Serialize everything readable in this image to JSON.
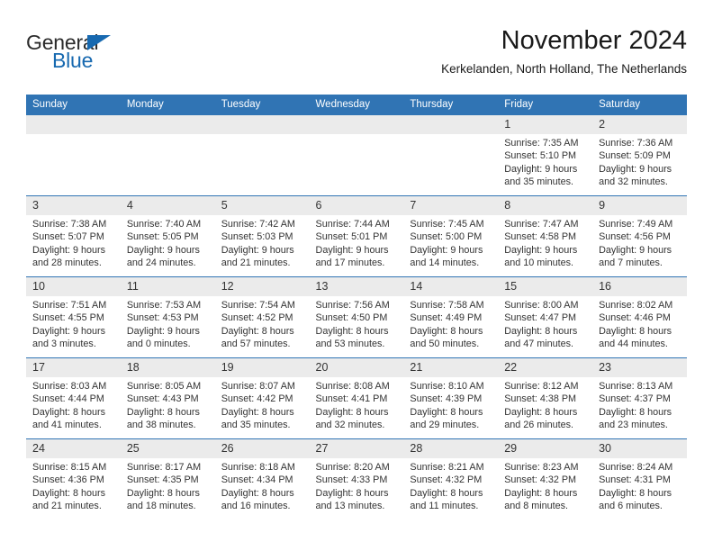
{
  "brand": {
    "name_part1": "General",
    "name_part2": "Blue",
    "triangle_color": "#1769b0",
    "accent_color": "#3074b4"
  },
  "header": {
    "title": "November 2024",
    "location": "Kerkelanden, North Holland, The Netherlands"
  },
  "calendar": {
    "weekday_headers": [
      "Sunday",
      "Monday",
      "Tuesday",
      "Wednesday",
      "Thursday",
      "Friday",
      "Saturday"
    ],
    "header_bg": "#3074b4",
    "daynum_bg": "#ebebeb",
    "weeks": [
      [
        {
          "day": "",
          "blank": true
        },
        {
          "day": "",
          "blank": true
        },
        {
          "day": "",
          "blank": true
        },
        {
          "day": "",
          "blank": true
        },
        {
          "day": "",
          "blank": true
        },
        {
          "day": "1",
          "sunrise": "Sunrise: 7:35 AM",
          "sunset": "Sunset: 5:10 PM",
          "daylight1": "Daylight: 9 hours",
          "daylight2": "and 35 minutes."
        },
        {
          "day": "2",
          "sunrise": "Sunrise: 7:36 AM",
          "sunset": "Sunset: 5:09 PM",
          "daylight1": "Daylight: 9 hours",
          "daylight2": "and 32 minutes."
        }
      ],
      [
        {
          "day": "3",
          "sunrise": "Sunrise: 7:38 AM",
          "sunset": "Sunset: 5:07 PM",
          "daylight1": "Daylight: 9 hours",
          "daylight2": "and 28 minutes."
        },
        {
          "day": "4",
          "sunrise": "Sunrise: 7:40 AM",
          "sunset": "Sunset: 5:05 PM",
          "daylight1": "Daylight: 9 hours",
          "daylight2": "and 24 minutes."
        },
        {
          "day": "5",
          "sunrise": "Sunrise: 7:42 AM",
          "sunset": "Sunset: 5:03 PM",
          "daylight1": "Daylight: 9 hours",
          "daylight2": "and 21 minutes."
        },
        {
          "day": "6",
          "sunrise": "Sunrise: 7:44 AM",
          "sunset": "Sunset: 5:01 PM",
          "daylight1": "Daylight: 9 hours",
          "daylight2": "and 17 minutes."
        },
        {
          "day": "7",
          "sunrise": "Sunrise: 7:45 AM",
          "sunset": "Sunset: 5:00 PM",
          "daylight1": "Daylight: 9 hours",
          "daylight2": "and 14 minutes."
        },
        {
          "day": "8",
          "sunrise": "Sunrise: 7:47 AM",
          "sunset": "Sunset: 4:58 PM",
          "daylight1": "Daylight: 9 hours",
          "daylight2": "and 10 minutes."
        },
        {
          "day": "9",
          "sunrise": "Sunrise: 7:49 AM",
          "sunset": "Sunset: 4:56 PM",
          "daylight1": "Daylight: 9 hours",
          "daylight2": "and 7 minutes."
        }
      ],
      [
        {
          "day": "10",
          "sunrise": "Sunrise: 7:51 AM",
          "sunset": "Sunset: 4:55 PM",
          "daylight1": "Daylight: 9 hours",
          "daylight2": "and 3 minutes."
        },
        {
          "day": "11",
          "sunrise": "Sunrise: 7:53 AM",
          "sunset": "Sunset: 4:53 PM",
          "daylight1": "Daylight: 9 hours",
          "daylight2": "and 0 minutes."
        },
        {
          "day": "12",
          "sunrise": "Sunrise: 7:54 AM",
          "sunset": "Sunset: 4:52 PM",
          "daylight1": "Daylight: 8 hours",
          "daylight2": "and 57 minutes."
        },
        {
          "day": "13",
          "sunrise": "Sunrise: 7:56 AM",
          "sunset": "Sunset: 4:50 PM",
          "daylight1": "Daylight: 8 hours",
          "daylight2": "and 53 minutes."
        },
        {
          "day": "14",
          "sunrise": "Sunrise: 7:58 AM",
          "sunset": "Sunset: 4:49 PM",
          "daylight1": "Daylight: 8 hours",
          "daylight2": "and 50 minutes."
        },
        {
          "day": "15",
          "sunrise": "Sunrise: 8:00 AM",
          "sunset": "Sunset: 4:47 PM",
          "daylight1": "Daylight: 8 hours",
          "daylight2": "and 47 minutes."
        },
        {
          "day": "16",
          "sunrise": "Sunrise: 8:02 AM",
          "sunset": "Sunset: 4:46 PM",
          "daylight1": "Daylight: 8 hours",
          "daylight2": "and 44 minutes."
        }
      ],
      [
        {
          "day": "17",
          "sunrise": "Sunrise: 8:03 AM",
          "sunset": "Sunset: 4:44 PM",
          "daylight1": "Daylight: 8 hours",
          "daylight2": "and 41 minutes."
        },
        {
          "day": "18",
          "sunrise": "Sunrise: 8:05 AM",
          "sunset": "Sunset: 4:43 PM",
          "daylight1": "Daylight: 8 hours",
          "daylight2": "and 38 minutes."
        },
        {
          "day": "19",
          "sunrise": "Sunrise: 8:07 AM",
          "sunset": "Sunset: 4:42 PM",
          "daylight1": "Daylight: 8 hours",
          "daylight2": "and 35 minutes."
        },
        {
          "day": "20",
          "sunrise": "Sunrise: 8:08 AM",
          "sunset": "Sunset: 4:41 PM",
          "daylight1": "Daylight: 8 hours",
          "daylight2": "and 32 minutes."
        },
        {
          "day": "21",
          "sunrise": "Sunrise: 8:10 AM",
          "sunset": "Sunset: 4:39 PM",
          "daylight1": "Daylight: 8 hours",
          "daylight2": "and 29 minutes."
        },
        {
          "day": "22",
          "sunrise": "Sunrise: 8:12 AM",
          "sunset": "Sunset: 4:38 PM",
          "daylight1": "Daylight: 8 hours",
          "daylight2": "and 26 minutes."
        },
        {
          "day": "23",
          "sunrise": "Sunrise: 8:13 AM",
          "sunset": "Sunset: 4:37 PM",
          "daylight1": "Daylight: 8 hours",
          "daylight2": "and 23 minutes."
        }
      ],
      [
        {
          "day": "24",
          "sunrise": "Sunrise: 8:15 AM",
          "sunset": "Sunset: 4:36 PM",
          "daylight1": "Daylight: 8 hours",
          "daylight2": "and 21 minutes."
        },
        {
          "day": "25",
          "sunrise": "Sunrise: 8:17 AM",
          "sunset": "Sunset: 4:35 PM",
          "daylight1": "Daylight: 8 hours",
          "daylight2": "and 18 minutes."
        },
        {
          "day": "26",
          "sunrise": "Sunrise: 8:18 AM",
          "sunset": "Sunset: 4:34 PM",
          "daylight1": "Daylight: 8 hours",
          "daylight2": "and 16 minutes."
        },
        {
          "day": "27",
          "sunrise": "Sunrise: 8:20 AM",
          "sunset": "Sunset: 4:33 PM",
          "daylight1": "Daylight: 8 hours",
          "daylight2": "and 13 minutes."
        },
        {
          "day": "28",
          "sunrise": "Sunrise: 8:21 AM",
          "sunset": "Sunset: 4:32 PM",
          "daylight1": "Daylight: 8 hours",
          "daylight2": "and 11 minutes."
        },
        {
          "day": "29",
          "sunrise": "Sunrise: 8:23 AM",
          "sunset": "Sunset: 4:32 PM",
          "daylight1": "Daylight: 8 hours",
          "daylight2": "and 8 minutes."
        },
        {
          "day": "30",
          "sunrise": "Sunrise: 8:24 AM",
          "sunset": "Sunset: 4:31 PM",
          "daylight1": "Daylight: 8 hours",
          "daylight2": "and 6 minutes."
        }
      ]
    ]
  }
}
